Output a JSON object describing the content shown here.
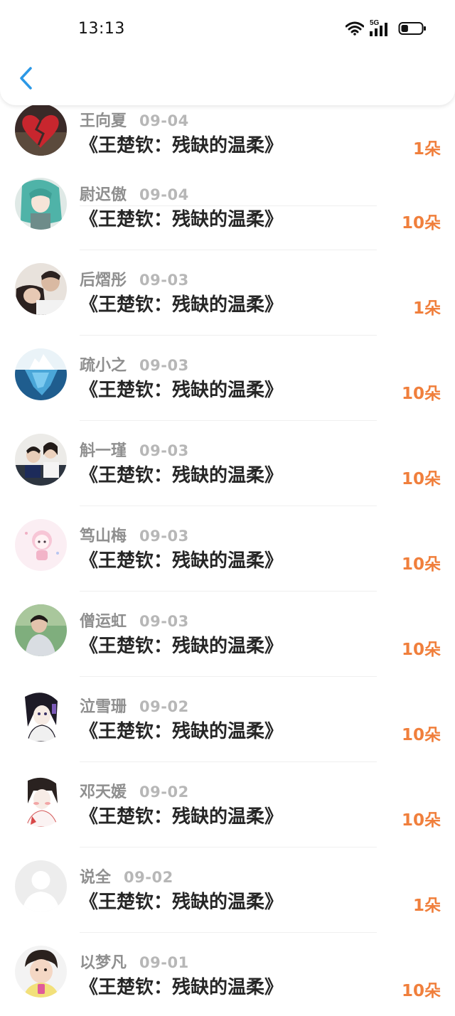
{
  "status_bar": {
    "time": "13:13",
    "network": "5G",
    "battery_level": 0.35
  },
  "header": {
    "back_icon": "chevron-left-icon"
  },
  "colors": {
    "accent": "#2b98e6",
    "amount": "#f07f3c",
    "username": "#8f8f8f",
    "date": "#b7b7b7",
    "title": "#262626"
  },
  "records": [
    {
      "user": "王向夏",
      "date": "09-04",
      "title": "《王楚钦：残缺的温柔》",
      "amount": "1朵",
      "avatar": "broken-heart-avatar"
    },
    {
      "user": "尉迟傲",
      "date": "09-04",
      "title": "《王楚钦：残缺的温柔》",
      "amount": "10朵",
      "avatar": "anime-girl-avatar"
    },
    {
      "user": "后熠彤",
      "date": "09-03",
      "title": "《王楚钦：残缺的温柔》",
      "amount": "1朵",
      "avatar": "couple-avatar"
    },
    {
      "user": "疏小之",
      "date": "09-03",
      "title": "《王楚钦：残缺的温柔》",
      "amount": "10朵",
      "avatar": "iceberg-avatar"
    },
    {
      "user": "斛一瑾",
      "date": "09-03",
      "title": "《王楚钦：残缺的温柔》",
      "amount": "10朵",
      "avatar": "kids-avatar"
    },
    {
      "user": "笃山梅",
      "date": "09-03",
      "title": "《王楚钦：残缺的温柔》",
      "amount": "10朵",
      "avatar": "cartoon-girl-avatar"
    },
    {
      "user": "僧运虹",
      "date": "09-03",
      "title": "《王楚钦：残缺的温柔》",
      "amount": "10朵",
      "avatar": "boy-photo-avatar"
    },
    {
      "user": "泣雪珊",
      "date": "09-02",
      "title": "《王楚钦：残缺的温柔》",
      "amount": "10朵",
      "avatar": "manga-girl-avatar"
    },
    {
      "user": "邓天媛",
      "date": "09-02",
      "title": "《王楚钦：残缺的温柔》",
      "amount": "10朵",
      "avatar": "sketch-girl-avatar"
    },
    {
      "user": "说全",
      "date": "09-02",
      "title": "《王楚钦：残缺的温柔》",
      "amount": "1朵",
      "avatar": "default-user-avatar"
    },
    {
      "user": "以梦凡",
      "date": "09-01",
      "title": "《王楚钦：残缺的温柔》",
      "amount": "10朵",
      "avatar": "child-photo-avatar"
    }
  ]
}
